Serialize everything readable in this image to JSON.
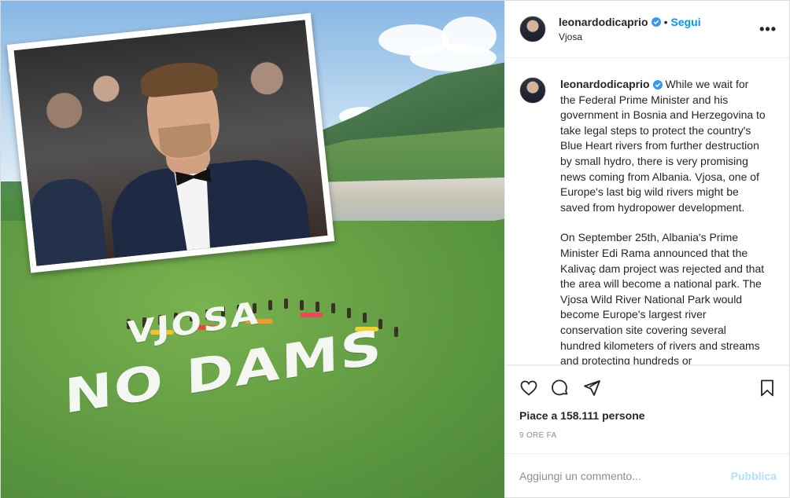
{
  "post": {
    "username": "leonardodicaprio",
    "follow_label": "Segui",
    "separator": "•",
    "location": "Vjosa",
    "more_label": "•••"
  },
  "image": {
    "slogan_line1": "VJOSA",
    "slogan_line2": "NO DAMS"
  },
  "caption": {
    "username": "leonardodicaprio",
    "paragraph1": "While we wait for the Federal Prime Minister and his government in Bosnia and Herzegovina to take legal steps to protect the country's Blue Heart rivers from further destruction by small hydro, there is very promising news coming from Albania. Vjosa, one of Europe's last big wild rivers might be saved from hydropower development.",
    "paragraph2": "On September 25th, Albania's Prime Minister Edi Rama announced that the Kalivaç dam project was rejected and that the area will become a national park. The Vjosa Wild River National Park would become Europe's largest river conservation site covering several hundred kilometers of rivers and streams and protecting hundreds or"
  },
  "actions": {
    "like_icon": "heart-icon",
    "comment_icon": "comment-icon",
    "share_icon": "send-icon",
    "save_icon": "bookmark-icon"
  },
  "likes": "Piace a 158.111 persone",
  "timestamp": "9 ORE FA",
  "comment": {
    "placeholder": "Aggiungi un commento...",
    "publish_label": "Pubblica"
  },
  "colors": {
    "link": "#0095f6",
    "verified": "#3897f0",
    "publish_disabled": "#b2dffc",
    "muted": "#8e8e8e"
  }
}
